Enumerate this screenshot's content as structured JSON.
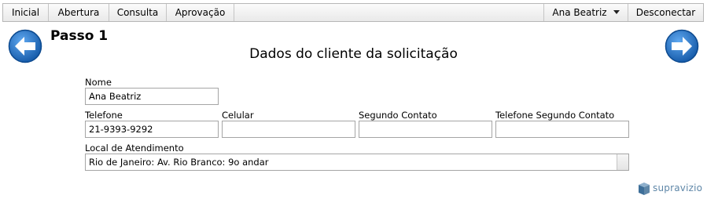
{
  "nav": {
    "items": [
      "Inicial",
      "Abertura",
      "Consulta",
      "Aprovação"
    ],
    "user": "Ana Beatriz",
    "logout": "Desconectar"
  },
  "step": {
    "title": "Passo 1"
  },
  "form": {
    "title": "Dados do cliente da solicitação",
    "nome": {
      "label": "Nome",
      "value": "Ana Beatriz"
    },
    "telefone": {
      "label": "Telefone",
      "value": "21-9393-9292"
    },
    "celular": {
      "label": "Celular",
      "value": ""
    },
    "segundo_contato": {
      "label": "Segundo Contato",
      "value": ""
    },
    "telefone_segundo_contato": {
      "label": "Telefone Segundo Contato",
      "value": ""
    },
    "local": {
      "label": "Local de Atendimento",
      "value": "Rio de Janeiro: Av. Rio Branco: 9o andar"
    }
  },
  "icons": {
    "back": "arrow-left-icon",
    "next": "arrow-right-icon",
    "logo": "supravizio-logo-icon"
  },
  "colors": {
    "arrow": "#1a63b6",
    "logo_text": "#5f87a8"
  },
  "brand": {
    "name": "supravizio"
  }
}
